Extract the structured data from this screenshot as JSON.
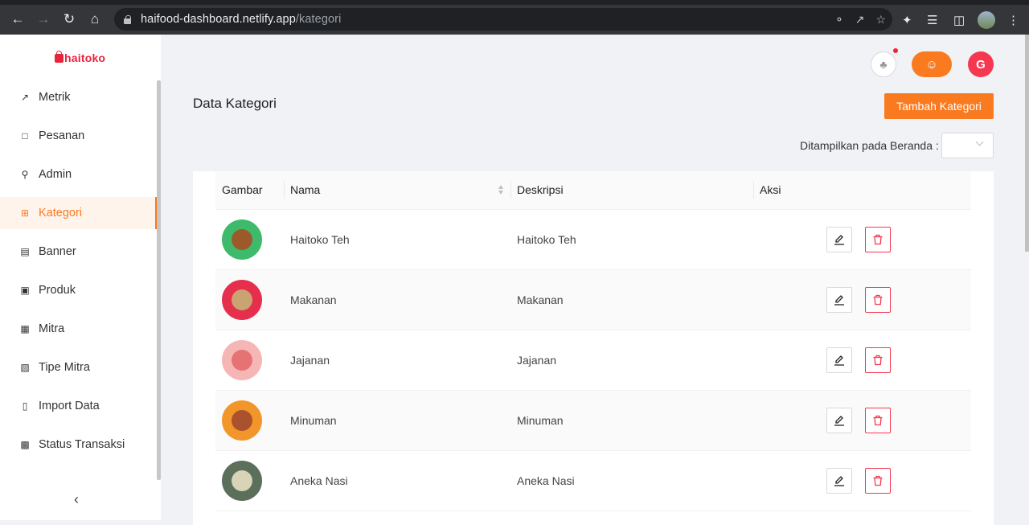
{
  "browser": {
    "url_host": "haifood-dashboard.netlify.app",
    "url_path": "/kategori"
  },
  "brand": {
    "name": "haitoko",
    "color": "#e8233e"
  },
  "accent_color": "#fa7a20",
  "sidebar": {
    "items": [
      {
        "label": "Metrik",
        "icon": "trend-up-icon",
        "active": false
      },
      {
        "label": "Pesanan",
        "icon": "shopping-bag-icon",
        "active": false
      },
      {
        "label": "Admin",
        "icon": "user-icon",
        "active": false
      },
      {
        "label": "Kategori",
        "icon": "grid-icon",
        "active": true
      },
      {
        "label": "Banner",
        "icon": "inbox-icon",
        "active": false
      },
      {
        "label": "Produk",
        "icon": "box-icon",
        "active": false
      },
      {
        "label": "Mitra",
        "icon": "bank-icon",
        "active": false
      },
      {
        "label": "Tipe Mitra",
        "icon": "group-icon",
        "active": false
      },
      {
        "label": "Import Data",
        "icon": "file-icon",
        "active": false
      },
      {
        "label": "Status Transaksi",
        "icon": "chart-board-icon",
        "active": false
      }
    ],
    "collapse_icon": "chevron-left-icon"
  },
  "header": {
    "notification_icon": "bell-icon",
    "user_icon": "user-icon",
    "logout_icon": "google-logout-icon"
  },
  "page": {
    "title": "Data Kategori",
    "add_button": "Tambah Kategori",
    "filter_label": "Ditampilkan pada Beranda",
    "filter_value": ""
  },
  "table": {
    "columns": [
      "Gambar",
      "Nama",
      "Deskripsi",
      "Aksi"
    ],
    "rows": [
      {
        "image_colors": [
          "#3dbb6b",
          "#9c5a2b"
        ],
        "nama": "Haitoko Teh",
        "deskripsi": "Haitoko Teh"
      },
      {
        "image_colors": [
          "#e62e4d",
          "#c9a472"
        ],
        "nama": "Makanan",
        "deskripsi": "Makanan"
      },
      {
        "image_colors": [
          "#f7b6b6",
          "#e57373"
        ],
        "nama": "Jajanan",
        "deskripsi": "Jajanan"
      },
      {
        "image_colors": [
          "#f2962b",
          "#a9522d"
        ],
        "nama": "Minuman",
        "deskripsi": "Minuman"
      },
      {
        "image_colors": [
          "#5b6f5a",
          "#d9d3b8"
        ],
        "nama": "Aneka Nasi",
        "deskripsi": "Aneka Nasi"
      }
    ],
    "edit_icon": "pencil-icon",
    "delete_icon": "trash-icon"
  }
}
